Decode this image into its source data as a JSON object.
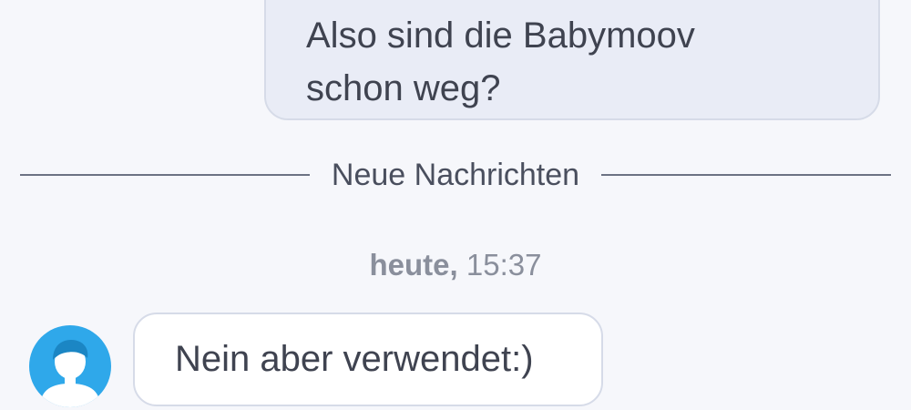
{
  "messages": {
    "outgoing": {
      "line1": "Also sind die Babymoov",
      "line2": "schon weg?"
    },
    "divider_label": "Neue Nachrichten",
    "timestamp": {
      "day": "heute,",
      "time": "15:37"
    },
    "incoming": {
      "text": "Nein aber verwendet:)",
      "avatar_icon": "user-avatar-icon"
    }
  },
  "colors": {
    "background": "#f6f7fb",
    "outgoing_bubble": "#e9ecf6",
    "incoming_bubble": "#ffffff",
    "avatar": "#2fa8ea",
    "text": "#3f4350",
    "muted_text": "#8a8f9c"
  }
}
